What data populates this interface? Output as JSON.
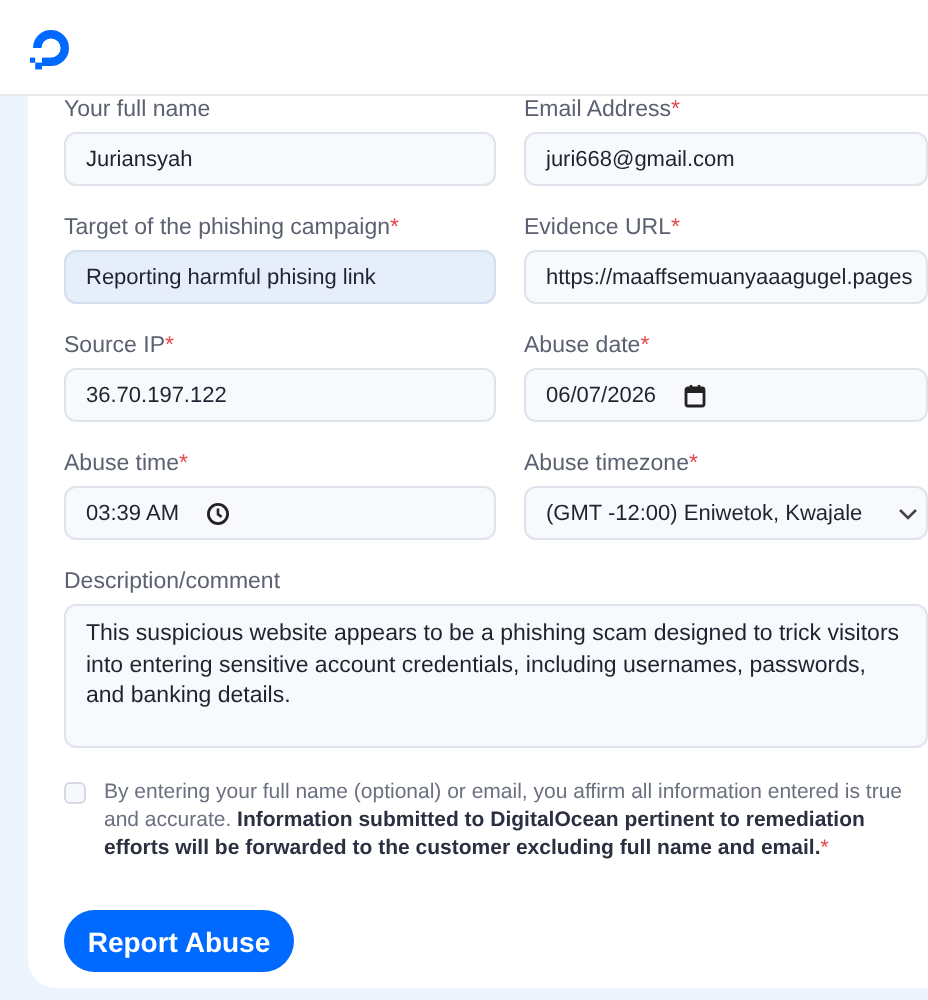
{
  "form": {
    "fields": [
      {
        "kind": "text",
        "label": "Your full name",
        "value": "Juriansyah",
        "highlighted": false
      },
      {
        "kind": "text",
        "label": "Email Address",
        "required_mark": "*",
        "value": "juri668@gmail.com",
        "highlighted": false
      },
      {
        "kind": "text",
        "label": "Target of the phishing campaign",
        "required_mark": "*",
        "value": "Reporting harmful phising link",
        "highlighted": true
      },
      {
        "kind": "text",
        "label": "Evidence URL",
        "required_mark": "*",
        "value": "https://maaffsemuanyaaagugel.pages",
        "highlighted": false
      },
      {
        "kind": "text",
        "label": "Source IP",
        "required_mark": "*",
        "value": "36.70.197.122",
        "highlighted": false
      },
      {
        "kind": "date",
        "label": "Abuse date",
        "required_mark": "*",
        "value": "06/07/2026",
        "highlighted": false
      },
      {
        "kind": "time",
        "label": "Abuse time",
        "required_mark": "*",
        "value": "03:39 AM",
        "highlighted": false
      },
      {
        "kind": "select",
        "label": "Abuse timezone",
        "required_mark": "*",
        "value": "(GMT -12:00) Eniwetok, Kwajale",
        "highlighted": false
      },
      {
        "kind": "textarea",
        "label": "Description/comment",
        "value": "This suspicious website appears to be a phishing scam designed to trick visitors into entering sensitive account credentials, including usernames, passwords, and banking details.",
        "highlighted": false
      }
    ],
    "consent": {
      "checked": false,
      "text": "By entering your full name (optional) or email, you affirm all information entered is true and accurate. **Information submitted to DigitalOcean pertinent to remediation efforts will be forwarded to the customer excluding full name and email.**",
      "required_mark": "*"
    },
    "submit": {
      "label": "Report Abuse"
    }
  }
}
